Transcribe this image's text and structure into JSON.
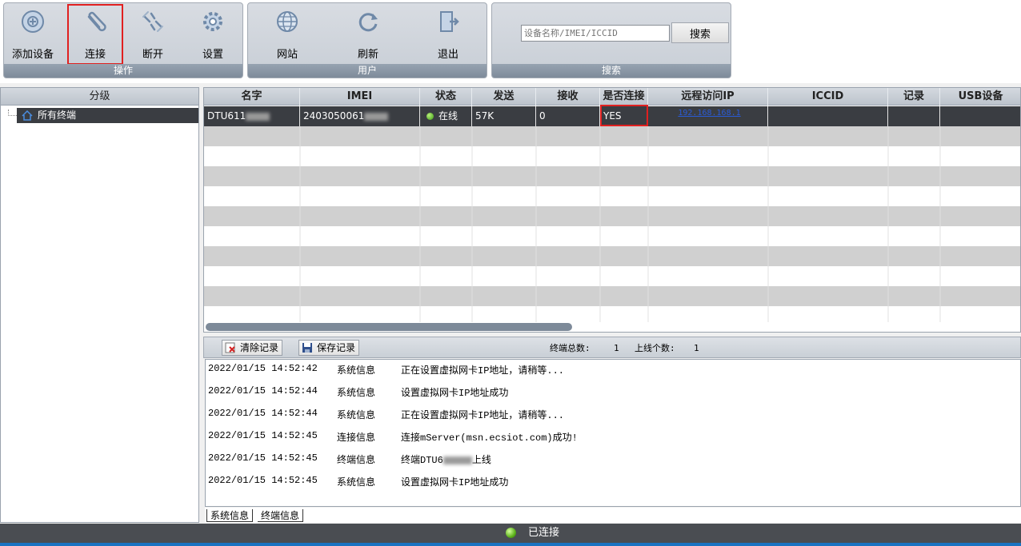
{
  "ribbon": {
    "groups": [
      {
        "caption": "操作",
        "tools": [
          {
            "label": "添加设备",
            "icon": "add-device-icon"
          },
          {
            "label": "连接",
            "icon": "paperclip-icon"
          },
          {
            "label": "断开",
            "icon": "broken-link-icon"
          },
          {
            "label": "设置",
            "icon": "gear-icon"
          }
        ]
      },
      {
        "caption": "用户",
        "tools": [
          {
            "label": "网站",
            "icon": "globe-icon"
          },
          {
            "label": "刷新",
            "icon": "refresh-icon"
          },
          {
            "label": "退出",
            "icon": "exit-door-icon"
          }
        ]
      },
      {
        "caption": "搜索"
      }
    ],
    "search": {
      "placeholder": "设备名称/IMEI/ICCID",
      "button": "搜索"
    }
  },
  "tree": {
    "header": "分级",
    "root": "所有终端"
  },
  "grid": {
    "columns": [
      "名字",
      "IMEI",
      "状态",
      "发送",
      "接收",
      "是否连接",
      "远程访问IP",
      "ICCID",
      "记录",
      "USB设备"
    ],
    "rows": [
      {
        "name": "DTU611",
        "imei": "2403050061",
        "status": "在线",
        "sent": "57K",
        "recv": "0",
        "connected": "YES",
        "ip": "192.168.168.1",
        "iccid": "",
        "record": "",
        "usb": ""
      }
    ]
  },
  "log": {
    "clear_label": "清除记录",
    "save_label": "保存记录",
    "total_label": "终端总数:",
    "total_value": "1",
    "online_label": "上线个数:",
    "online_value": "1",
    "entries": [
      {
        "time": "2022/01/15 14:52:42",
        "type": "系统信息",
        "msg": "正在设置虚拟网卡IP地址，请稍等..."
      },
      {
        "time": "2022/01/15 14:52:44",
        "type": "系统信息",
        "msg": "设置虚拟网卡IP地址成功"
      },
      {
        "time": "2022/01/15 14:52:44",
        "type": "系统信息",
        "msg": "正在设置虚拟网卡IP地址，请稍等..."
      },
      {
        "time": "2022/01/15 14:52:45",
        "type": "连接信息",
        "msg": "连接mServer(msn.ecsiot.com)成功!"
      },
      {
        "time": "2022/01/15 14:52:45",
        "type": "终端信息",
        "msg_prefix": "终端DTU6",
        "msg_suffix": "上线"
      },
      {
        "time": "2022/01/15 14:52:45",
        "type": "系统信息",
        "msg": "设置虚拟网卡IP地址成功"
      }
    ],
    "tabs": [
      "系统信息",
      "终端信息"
    ]
  },
  "status": {
    "text": "已连接"
  },
  "colors": {
    "highlight_box": "#e02020",
    "selected_row": "#3a3d42",
    "status_bar": "#4a4d52"
  }
}
